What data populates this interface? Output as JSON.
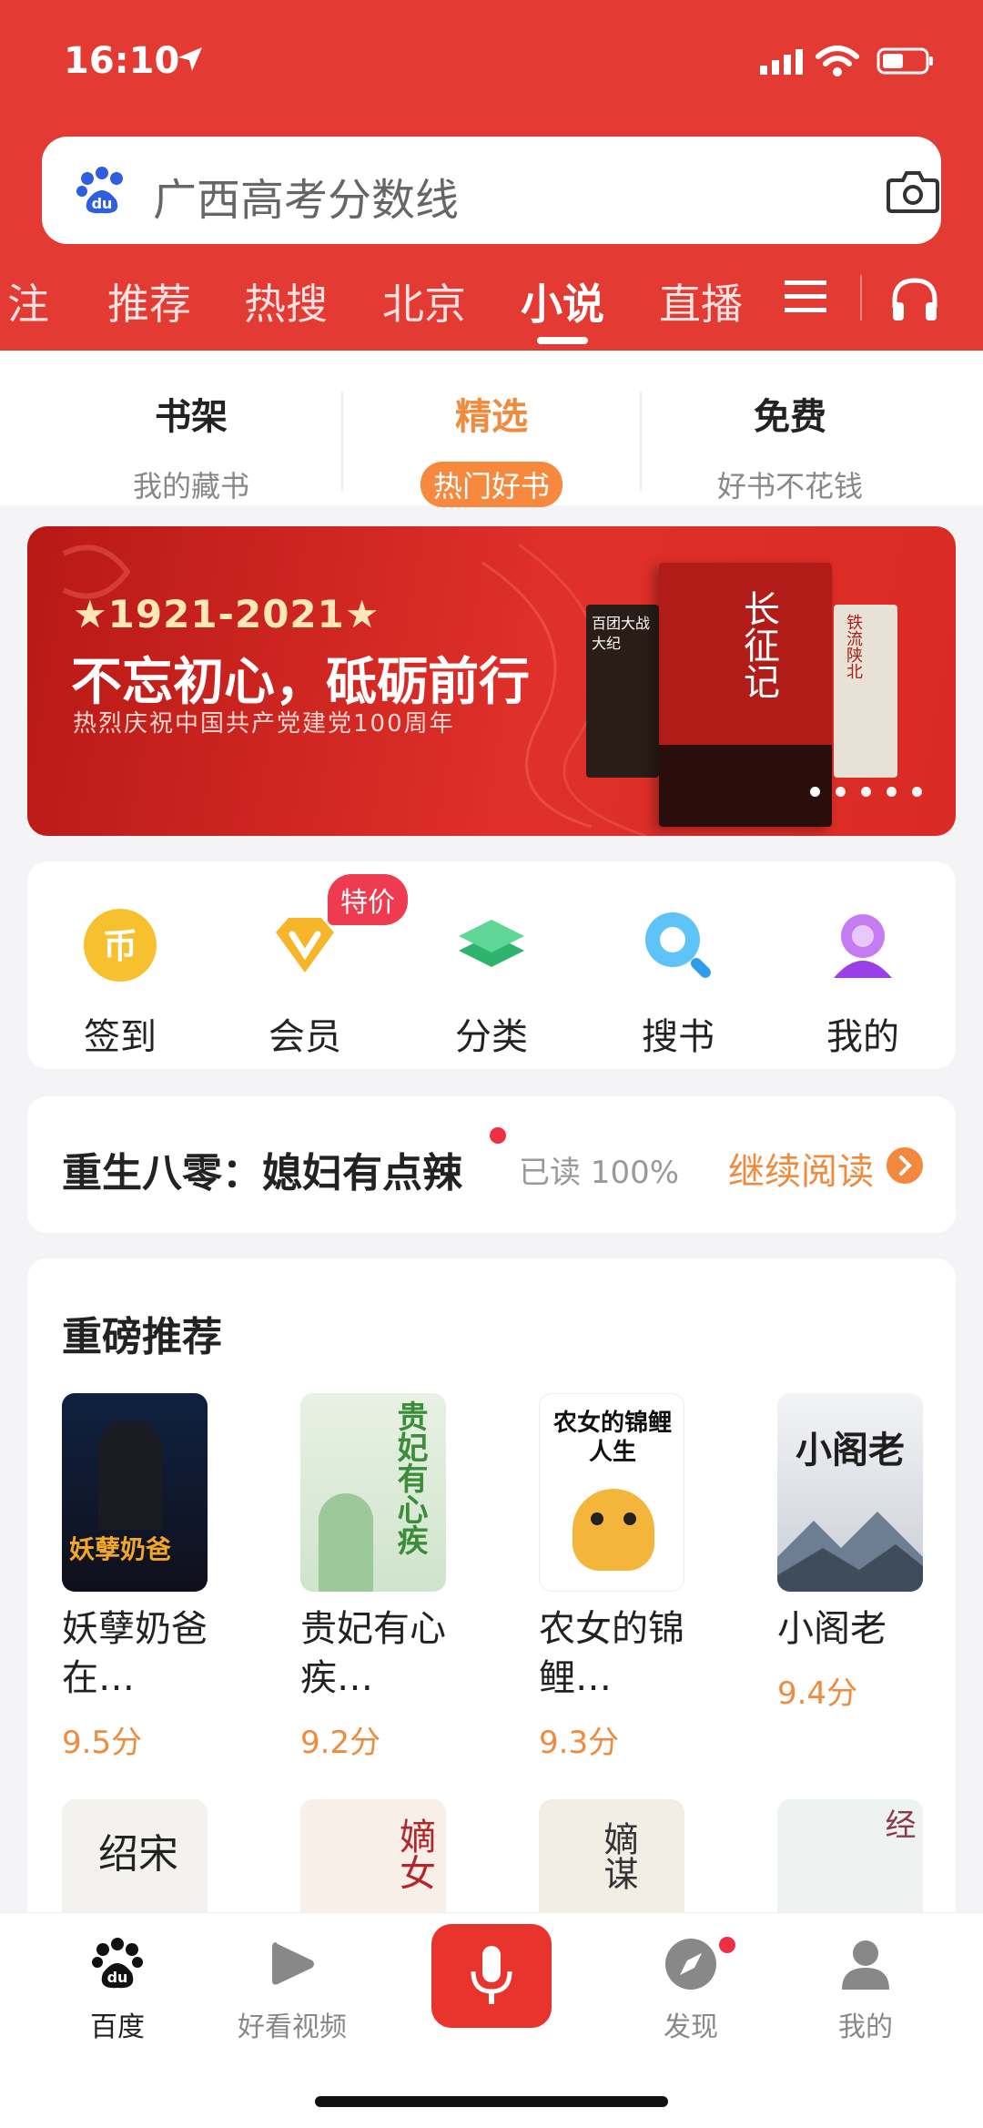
{
  "status": {
    "time": "16:10"
  },
  "search": {
    "query": "广西高考分数线"
  },
  "top_tabs": [
    "注",
    "推荐",
    "热搜",
    "北京",
    "小说",
    "直播"
  ],
  "sub_tabs": [
    {
      "title": "书架",
      "subtitle": "我的藏书"
    },
    {
      "title": "精选",
      "subtitle": "热门好书"
    },
    {
      "title": "免费",
      "subtitle": "好书不花钱"
    }
  ],
  "banner": {
    "years": "★1921-2021★",
    "headline": "不忘初心，砥砺前行",
    "subtitle": "热烈庆祝中国共产党建党100周年",
    "book1": "百团大战大纪",
    "book2": "长征记",
    "book3": "铁流陕北"
  },
  "quick_actions": {
    "items": [
      "签到",
      "会员",
      "分类",
      "搜书",
      "我的"
    ],
    "badge": "特价"
  },
  "reading": {
    "title": "重生八零：媳妇有点辣",
    "progress": "已读 100%",
    "continue": "继续阅读"
  },
  "recommend": {
    "heading": "重磅推荐",
    "books": [
      {
        "name": "妖孽奶爸在…",
        "score": "9.5分",
        "cover_text": "妖孽奶爸"
      },
      {
        "name": "贵妃有心疾…",
        "score": "9.2分",
        "cover_text": "贵妃有心疾"
      },
      {
        "name": "农女的锦鲤…",
        "score": "9.3分",
        "cover_text": "农女的锦鲤人生"
      },
      {
        "name": "小阁老",
        "score": "9.4分",
        "cover_text": "小阁老"
      }
    ],
    "row2_covers": [
      "绍宋",
      "嫡女",
      "嫡谋",
      "娇娘医经"
    ]
  },
  "bottom_nav": [
    "百度",
    "好看视频",
    "发现",
    "我的"
  ],
  "colors": {
    "brand_red": "#e33a33",
    "accent_orange": "#f08a3c"
  }
}
